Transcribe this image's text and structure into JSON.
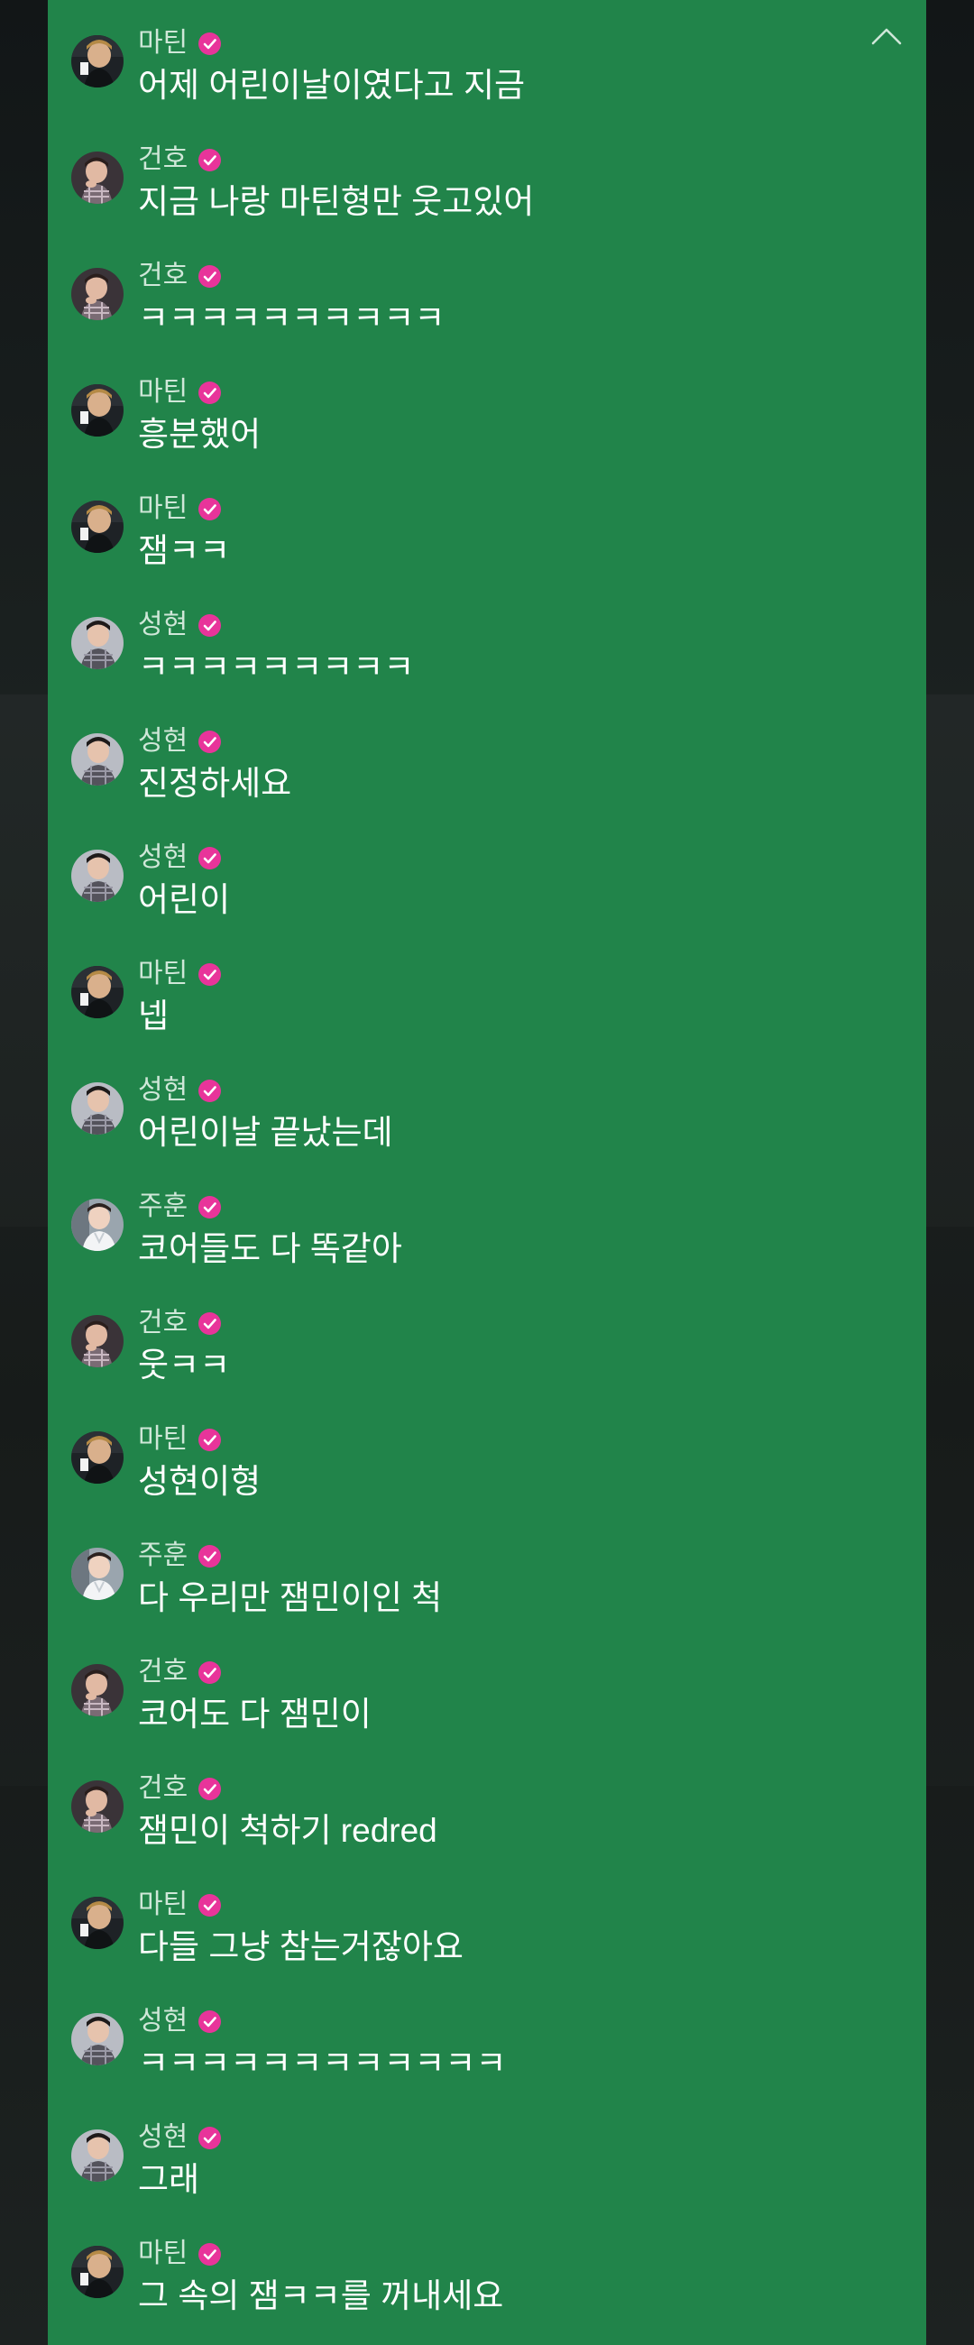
{
  "colors": {
    "panel_bg": "#21844a",
    "name_text": "#cfe7d8",
    "message_text": "#ffffff",
    "verified_badge": "#e8349a",
    "page_bg": "#15191a"
  },
  "panel": {
    "collapse_icon": "chevron-up-icon"
  },
  "messages": [
    {
      "name": "마틴",
      "avatar": "martin",
      "text": "어제 어린이날이였다고 지금"
    },
    {
      "name": "건호",
      "avatar": "gunho",
      "text": "지금 나랑 마틴형만 웃고있어"
    },
    {
      "name": "건호",
      "avatar": "gunho",
      "text": "ㅋㅋㅋㅋㅋㅋㅋㅋㅋㅋ"
    },
    {
      "name": "마틴",
      "avatar": "martin",
      "text": "흥분했어"
    },
    {
      "name": "마틴",
      "avatar": "martin",
      "text": "잼ㅋㅋ"
    },
    {
      "name": "성현",
      "avatar": "sunghyun",
      "text": "ㅋㅋㅋㅋㅋㅋㅋㅋㅋ"
    },
    {
      "name": "성현",
      "avatar": "sunghyun",
      "text": "진정하세요"
    },
    {
      "name": "성현",
      "avatar": "sunghyun",
      "text": "어린이"
    },
    {
      "name": "마틴",
      "avatar": "martin",
      "text": "넵"
    },
    {
      "name": "성현",
      "avatar": "sunghyun",
      "text": "어린이날 끝났는데"
    },
    {
      "name": "주훈",
      "avatar": "juhoon",
      "text": "코어들도 다 똑같아"
    },
    {
      "name": "건호",
      "avatar": "gunho",
      "text": "웃ㅋㅋ"
    },
    {
      "name": "마틴",
      "avatar": "martin",
      "text": "성현이형"
    },
    {
      "name": "주훈",
      "avatar": "juhoon",
      "text": "다 우리만 잼민이인 척"
    },
    {
      "name": "건호",
      "avatar": "gunho",
      "text": "코어도 다 잼민이"
    },
    {
      "name": "건호",
      "avatar": "gunho",
      "text": "잼민이 척하기 redred"
    },
    {
      "name": "마틴",
      "avatar": "martin",
      "text": "다들 그냥 참는거잖아요"
    },
    {
      "name": "성현",
      "avatar": "sunghyun",
      "text": "ㅋㅋㅋㅋㅋㅋㅋㅋㅋㅋㅋㅋ"
    },
    {
      "name": "성현",
      "avatar": "sunghyun",
      "text": "그래"
    },
    {
      "name": "마틴",
      "avatar": "martin",
      "text": "그 속의 잼ㅋㅋ를 꺼내세요"
    }
  ]
}
